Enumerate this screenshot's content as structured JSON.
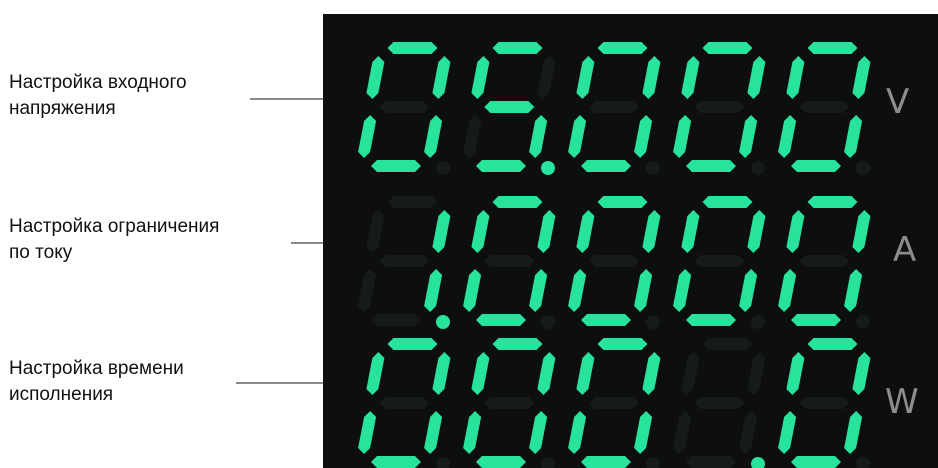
{
  "callouts": [
    {
      "line1": "Настройка входного",
      "line2": "напряжения"
    },
    {
      "line1": "Настройка ограничения",
      "line2": "по току"
    },
    {
      "line1": "Настройка времени",
      "line2": "исполнения"
    }
  ],
  "display": {
    "rows": [
      {
        "digits": "05000",
        "decimal_after": 2,
        "blank_positions": [],
        "unit": "V"
      },
      {
        "digits": "10000",
        "decimal_after": 1,
        "blank_positions": [],
        "unit": "A"
      },
      {
        "digits": "00010",
        "decimal_after": 4,
        "blank_positions": [
          3
        ],
        "unit": "W"
      }
    ]
  },
  "colors": {
    "segment_on": "#27e39c",
    "segment_off": "#161a18",
    "panel_background": "#0d0f0e",
    "unit_label": "#8d8d8d"
  }
}
